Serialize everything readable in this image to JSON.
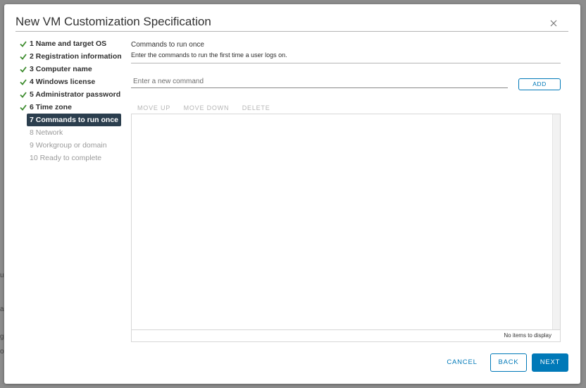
{
  "backdrop": {
    "fragments": [
      "u",
      "a",
      "g",
      "o"
    ]
  },
  "dialog": {
    "title": "New VM Customization Specification",
    "close_icon": "close-icon"
  },
  "steps": [
    {
      "label": "1 Name and target OS",
      "state": "done"
    },
    {
      "label": "2 Registration information",
      "state": "done"
    },
    {
      "label": "3 Computer name",
      "state": "done"
    },
    {
      "label": "4 Windows license",
      "state": "done"
    },
    {
      "label": "5 Administrator password",
      "state": "done"
    },
    {
      "label": "6 Time zone",
      "state": "done"
    },
    {
      "label": "7 Commands to run once",
      "state": "active"
    },
    {
      "label": "8 Network",
      "state": "future"
    },
    {
      "label": "9 Workgroup or domain",
      "state": "future"
    },
    {
      "label": "10 Ready to complete",
      "state": "future"
    }
  ],
  "content": {
    "heading": "Commands to run once",
    "description": "Enter the commands to run the first time a user logs on.",
    "command_input": {
      "placeholder": "Enter a new command",
      "value": ""
    },
    "add_label": "ADD",
    "toolbar": {
      "move_up": "MOVE UP",
      "move_down": "MOVE DOWN",
      "delete": "DELETE"
    },
    "grid_footer": "No items to display"
  },
  "footer": {
    "cancel": "CANCEL",
    "back": "BACK",
    "next": "NEXT"
  },
  "colors": {
    "accent": "#0079b8",
    "check": "#3c8b2d",
    "active_step_bg": "#2b3e4e"
  }
}
